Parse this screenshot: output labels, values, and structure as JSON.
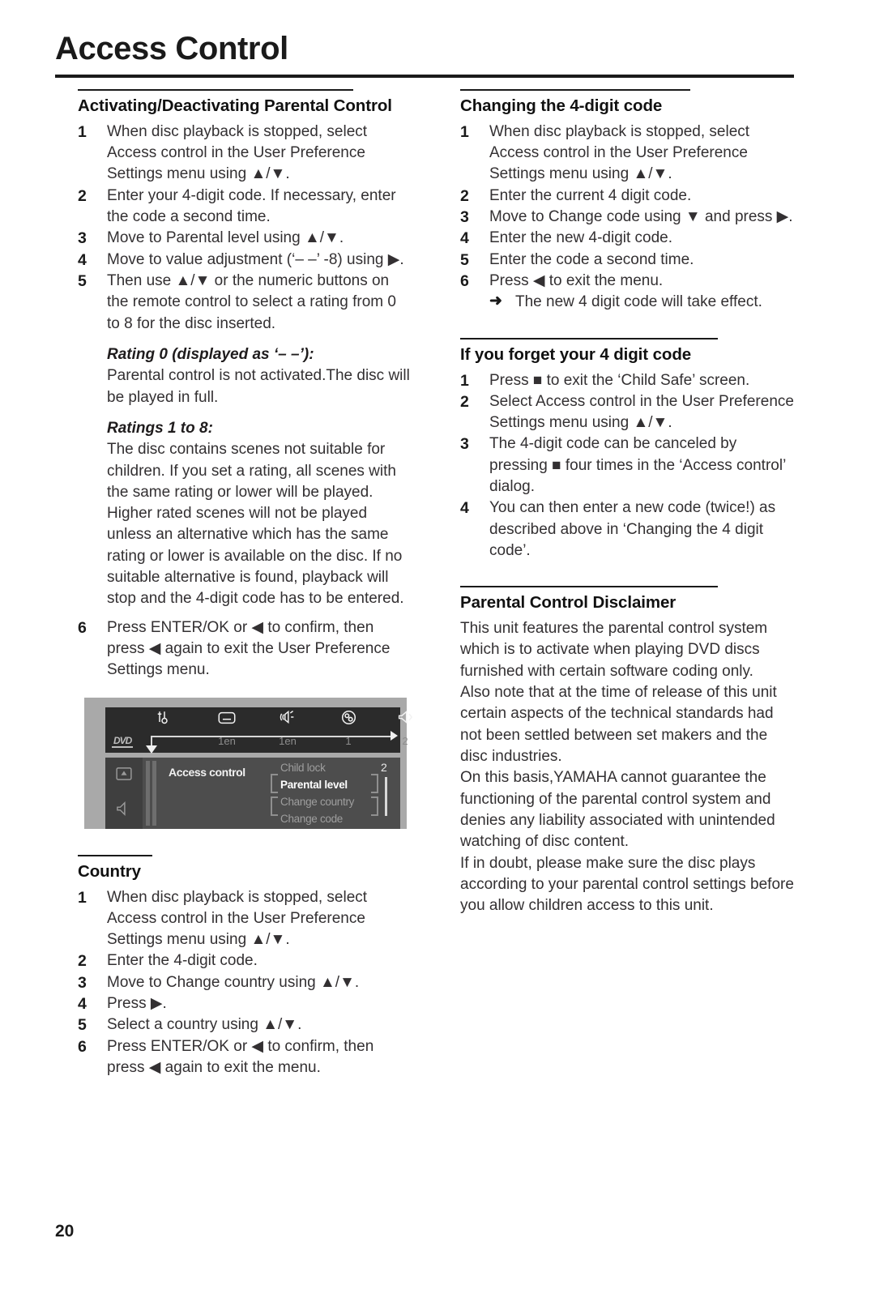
{
  "document": {
    "title": "Access Control",
    "page_number": "20"
  },
  "left_column": {
    "section_parental": {
      "heading": "Activating/Deactivating Parental Control",
      "steps": [
        "When disc playback is stopped, select Access control in the User Preference Settings menu using ▲/▼.",
        "Enter your 4-digit code. If necessary, enter the code a second time.",
        "Move to Parental level using ▲/▼.",
        "Move to value adjustment (‘– –’ -8) using ▶.",
        "Then use ▲/▼ or the numeric buttons on the remote control to select a rating from 0 to 8 for the disc inserted."
      ],
      "rating0_heading": "Rating 0 (displayed as ‘– –’):",
      "rating0_text": "Parental control is not activated.The disc will be played in full.",
      "ratings18_heading": "Ratings 1 to 8:",
      "ratings18_text": "The disc contains scenes not suitable for children. If you set a rating, all scenes with the same rating or lower will be played. Higher rated scenes will not be played unless an alternative which has the same rating or lower is available on the disc. If no suitable alternative is found, playback will stop and the 4-digit code has to be entered.",
      "step6": "Press ENTER/OK or ◀ to confirm, then press ◀ again to exit the User Preference Settings menu."
    },
    "osd_screenshot": {
      "menu_icons": [
        "tools-icon",
        "subtitle-icon",
        "audio-icon",
        "disc-language-icon",
        "sound-icon"
      ],
      "disc_logo": "DVD",
      "menu_values": [
        "1en",
        "1en",
        "1",
        "2"
      ],
      "sidebar_icons": [
        "eject-icon",
        "mute-icon"
      ],
      "panel_title": "Access control",
      "list_items": [
        {
          "label": "Child lock",
          "selected": false
        },
        {
          "label": "Parental level",
          "selected": true
        },
        {
          "label": "Change country",
          "selected": false
        },
        {
          "label": "Change code",
          "selected": false
        }
      ],
      "value_indicator": "2"
    },
    "section_country": {
      "heading": "Country",
      "steps": [
        "When disc playback is stopped, select Access control in the User Preference Settings menu using ▲/▼.",
        "Enter the 4-digit code.",
        "Move to Change country using ▲/▼.",
        "Press ▶.",
        "Select a country using ▲/▼.",
        "Press ENTER/OK or ◀ to confirm, then press ◀ again to exit the menu."
      ]
    }
  },
  "right_column": {
    "section_changing_code": {
      "heading": "Changing the 4-digit code",
      "steps": [
        "When disc playback is stopped, select Access control in the User Preference Settings menu using ▲/▼.",
        "Enter the current 4 digit code.",
        "Move to Change code using ▼ and press ▶.",
        "Enter the new 4-digit code.",
        "Enter the code a second time.",
        "Press ◀ to exit the menu."
      ],
      "result_note": "The new 4 digit code will take effect.",
      "result_arrow": "➜"
    },
    "section_forgot_code": {
      "heading": "If you forget your 4 digit code",
      "steps": [
        "Press ■ to exit the ‘Child Safe’ screen.",
        "Select Access control in the User Preference Settings menu using ▲/▼.",
        "The 4-digit code can be canceled by pressing ■ four times in the ‘Access control’ dialog.",
        "You can then enter a new code (twice!) as described above in ‘Changing the 4 digit code’."
      ]
    },
    "section_disclaimer": {
      "heading": "Parental Control Disclaimer",
      "paragraphs": [
        "This unit features the parental control system which is to activate when playing DVD discs furnished with certain software coding only.",
        "Also note that at the time of release of this unit certain aspects of the technical standards had not been settled between set makers and the disc industries.",
        "On this basis,YAMAHA cannot guarantee the functioning of the parental control system and denies any liability associated with unintended watching of disc content.",
        "If in doubt, please make sure the disc plays according to your parental control settings before you allow children access to this unit."
      ]
    }
  }
}
